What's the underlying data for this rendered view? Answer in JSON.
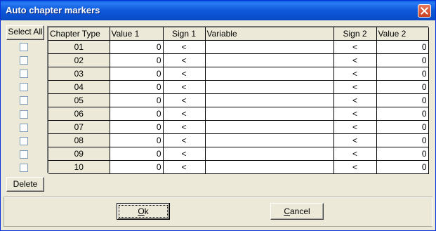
{
  "window": {
    "title": "Auto chapter markers"
  },
  "buttons": {
    "select_all": "Select All",
    "delete": "Delete",
    "ok_mnemonic": "O",
    "ok_rest": "k",
    "cancel_mnemonic": "C",
    "cancel_rest": "ancel"
  },
  "grid": {
    "headers": {
      "chapter_type": "Chapter Type",
      "value1": "Value 1",
      "sign1": "Sign 1",
      "variable": "Variable",
      "sign2": "Sign 2",
      "value2": "Value 2"
    },
    "rows": [
      {
        "type": "01",
        "value1": "0",
        "sign1": "<",
        "variable": "",
        "sign2": "<",
        "value2": "0",
        "checked": false
      },
      {
        "type": "02",
        "value1": "0",
        "sign1": "<",
        "variable": "",
        "sign2": "<",
        "value2": "0",
        "checked": false
      },
      {
        "type": "03",
        "value1": "0",
        "sign1": "<",
        "variable": "",
        "sign2": "<",
        "value2": "0",
        "checked": false
      },
      {
        "type": "04",
        "value1": "0",
        "sign1": "<",
        "variable": "",
        "sign2": "<",
        "value2": "0",
        "checked": false
      },
      {
        "type": "05",
        "value1": "0",
        "sign1": "<",
        "variable": "",
        "sign2": "<",
        "value2": "0",
        "checked": false
      },
      {
        "type": "06",
        "value1": "0",
        "sign1": "<",
        "variable": "",
        "sign2": "<",
        "value2": "0",
        "checked": false
      },
      {
        "type": "07",
        "value1": "0",
        "sign1": "<",
        "variable": "",
        "sign2": "<",
        "value2": "0",
        "checked": false
      },
      {
        "type": "08",
        "value1": "0",
        "sign1": "<",
        "variable": "",
        "sign2": "<",
        "value2": "0",
        "checked": false
      },
      {
        "type": "09",
        "value1": "0",
        "sign1": "<",
        "variable": "",
        "sign2": "<",
        "value2": "0",
        "checked": false
      },
      {
        "type": "10",
        "value1": "0",
        "sign1": "<",
        "variable": "",
        "sign2": "<",
        "value2": "0",
        "checked": false
      }
    ]
  },
  "colors": {
    "titlebar": "#0A5FE3",
    "face": "#ECE9D8",
    "close": "#C9401E"
  },
  "icons": {
    "close": "close-icon"
  }
}
